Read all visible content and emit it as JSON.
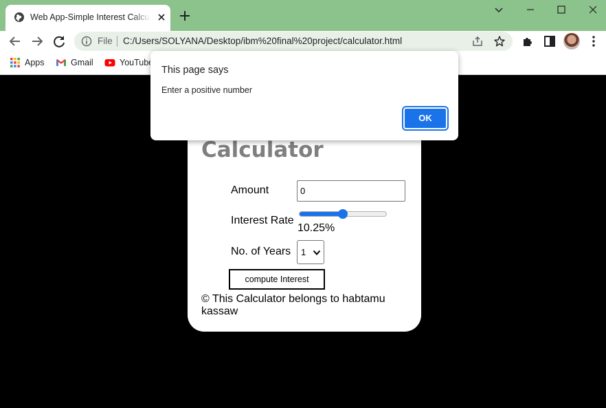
{
  "browser": {
    "tab_title": "Web App-Simple Interest Calculator",
    "omnibox": {
      "scheme_label": "File",
      "url": "C:/Users/SOLYANA/Desktop/ibm%20final%20project/calculator.html"
    },
    "bookmarks": [
      {
        "label": "Apps",
        "icon": "apps-grid-icon"
      },
      {
        "label": "Gmail",
        "icon": "gmail-icon"
      },
      {
        "label": "YouTube",
        "icon": "youtube-icon"
      }
    ],
    "colors": {
      "frame": "#8cc28b",
      "accent": "#1a73e8"
    }
  },
  "page": {
    "title": "Calculator",
    "amount_label": "Amount",
    "amount_value": "0",
    "rate_label": "Interest Rate",
    "rate_value_text": "10.25%",
    "rate_slider_fraction": 0.5,
    "years_label": "No. of Years",
    "years_value": "1",
    "compute_label": "compute Interest",
    "footer": "© This Calculator belongs to habtamu kassaw"
  },
  "dialog": {
    "title": "This page says",
    "message": "Enter a positive number",
    "ok_label": "OK"
  }
}
